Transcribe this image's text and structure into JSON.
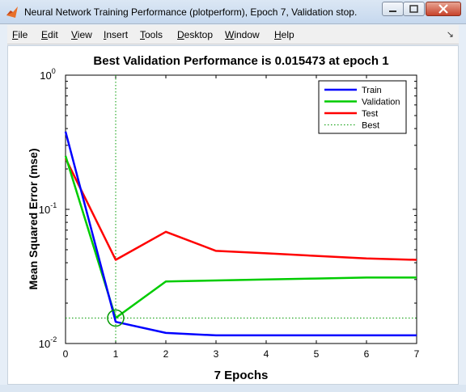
{
  "window": {
    "title": "Neural Network Training Performance (plotperform), Epoch 7, Validation stop.",
    "icon": "matlab-icon",
    "controls": [
      "minimize-icon",
      "maximize-icon",
      "close-icon"
    ]
  },
  "menu": {
    "items": [
      {
        "key": "F",
        "rest": "ile"
      },
      {
        "key": "E",
        "rest": "dit"
      },
      {
        "key": "V",
        "rest": "iew"
      },
      {
        "key": "I",
        "rest": "nsert"
      },
      {
        "key": "T",
        "rest": "ools"
      },
      {
        "key": "D",
        "rest": "esktop"
      },
      {
        "key": "W",
        "rest": "indow"
      },
      {
        "key": "H",
        "rest": "elp"
      }
    ],
    "dock_icon": "dock-arrow-icon",
    "dock_glyph": "↘"
  },
  "chart_data": {
    "type": "line",
    "title": "Best Validation Performance is 0.015473 at epoch 1",
    "xlabel": "7 Epochs",
    "ylabel": "Mean Squared Error  (mse)",
    "xlim": [
      0,
      7
    ],
    "ylim": [
      0.01,
      1
    ],
    "yscale": "log",
    "x_ticks": [
      0,
      1,
      2,
      3,
      4,
      5,
      6,
      7
    ],
    "y_ticks": [
      {
        "base": "10",
        "exp": "0",
        "value": 1
      },
      {
        "base": "10",
        "exp": "-1",
        "value": 0.1
      },
      {
        "base": "10",
        "exp": "-2",
        "value": 0.01
      }
    ],
    "grid": false,
    "legend_location": "top-right",
    "x": [
      0,
      1,
      2,
      3,
      4,
      5,
      6,
      7
    ],
    "series": [
      {
        "name": "Train",
        "color": "#0000ff",
        "values": [
          0.38,
          0.0145,
          0.012,
          0.0115,
          0.0115,
          0.0115,
          0.0115,
          0.0115
        ]
      },
      {
        "name": "Validation",
        "color": "#00cc00",
        "values": [
          0.25,
          0.0155,
          0.029,
          0.0295,
          0.03,
          0.0305,
          0.031,
          0.031
        ]
      },
      {
        "name": "Test",
        "color": "#ff0000",
        "values": [
          0.24,
          0.042,
          0.068,
          0.049,
          0.047,
          0.045,
          0.043,
          0.042
        ]
      }
    ],
    "best": {
      "name": "Best",
      "epoch": 1,
      "value": 0.015473,
      "color": "#009900",
      "line_style": "dotted"
    }
  }
}
